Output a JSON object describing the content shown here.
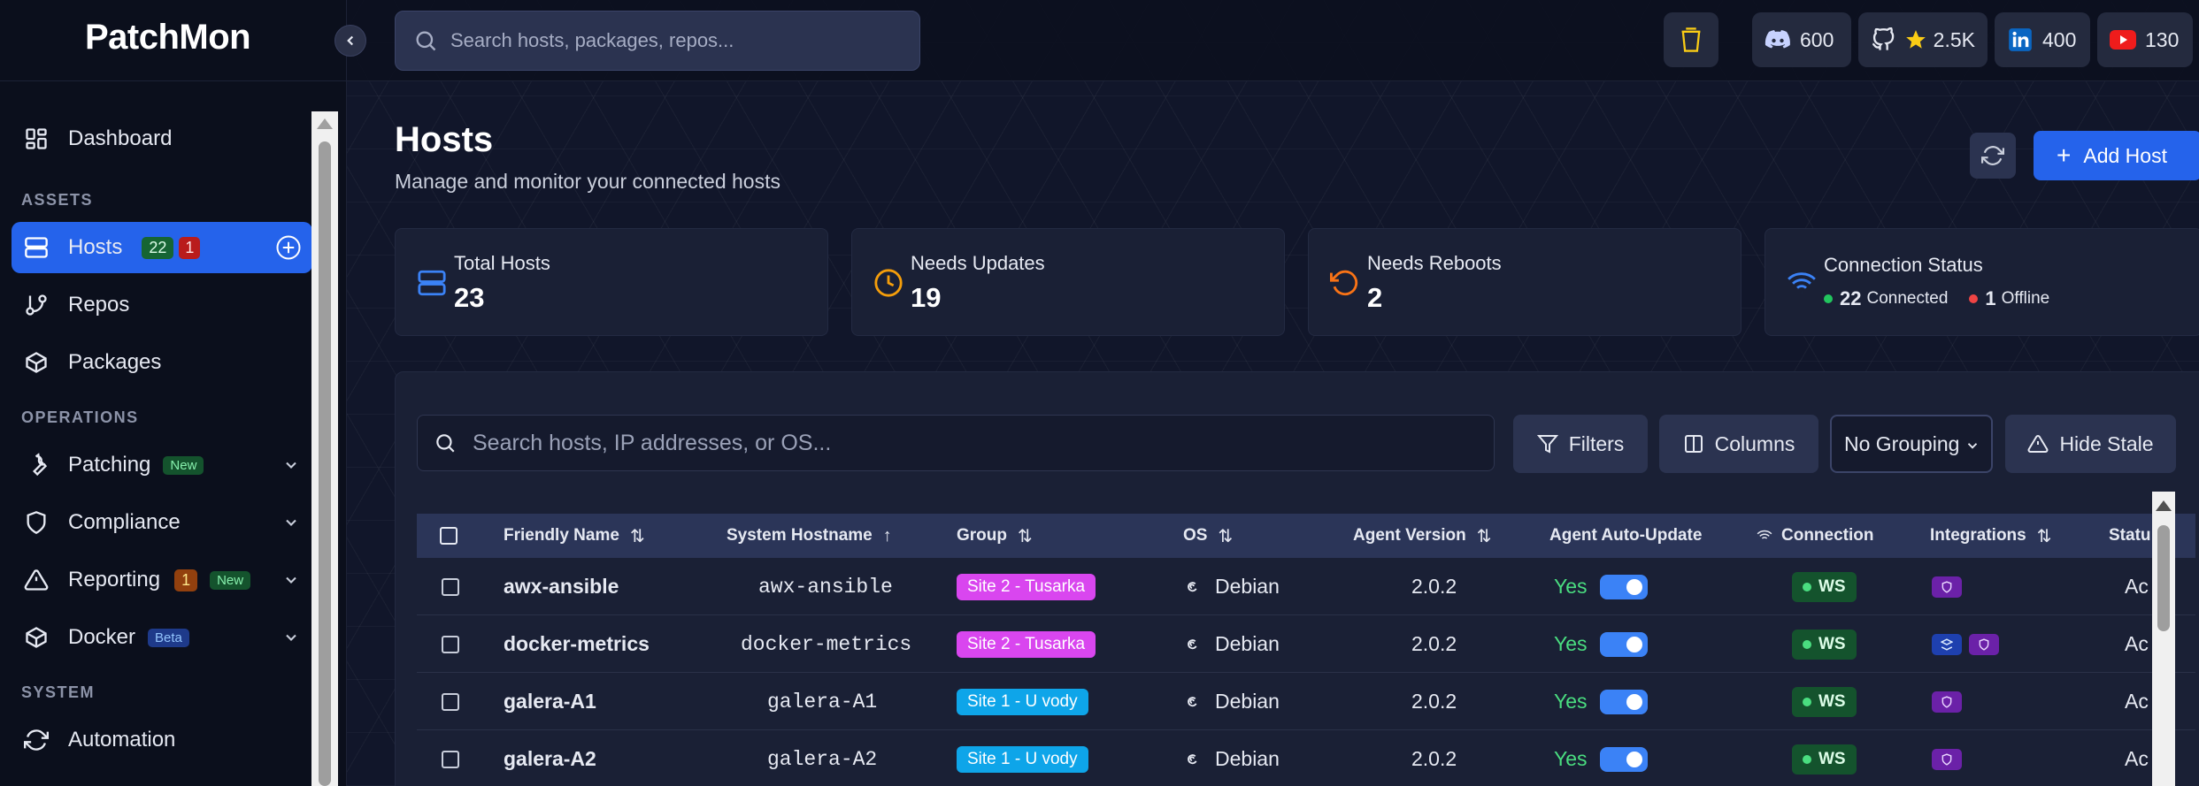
{
  "app": {
    "logo": "PatchMon"
  },
  "sidebar": {
    "dashboard": "Dashboard",
    "section_assets": "ASSETS",
    "hosts": "Hosts",
    "hosts_online": "22",
    "hosts_offline": "1",
    "repos": "Repos",
    "packages": "Packages",
    "section_operations": "OPERATIONS",
    "patching": "Patching",
    "patching_badge": "New",
    "compliance": "Compliance",
    "reporting": "Reporting",
    "reporting_count": "1",
    "reporting_badge": "New",
    "docker": "Docker",
    "docker_badge": "Beta",
    "section_system": "SYSTEM",
    "automation": "Automation"
  },
  "topbar": {
    "search_placeholder": "Search hosts, packages, repos...",
    "discord": "600",
    "github": "2.5K",
    "linkedin": "400",
    "youtube": "130"
  },
  "page": {
    "title": "Hosts",
    "subtitle": "Manage and monitor your connected hosts",
    "add_host": "Add Host"
  },
  "stats": {
    "total_label": "Total Hosts",
    "total_value": "23",
    "updates_label": "Needs Updates",
    "updates_value": "19",
    "reboots_label": "Needs Reboots",
    "reboots_value": "2",
    "conn_label": "Connection Status",
    "connected_value": "22",
    "connected_label": "Connected",
    "offline_value": "1",
    "offline_label": "Offline"
  },
  "toolbar": {
    "search_placeholder": "Search hosts, IP addresses, or OS...",
    "filters": "Filters",
    "columns": "Columns",
    "grouping": "No Grouping",
    "hide_stale": "Hide Stale"
  },
  "table": {
    "headers": {
      "friendly_name": "Friendly Name",
      "system_hostname": "System Hostname",
      "group": "Group",
      "os": "OS",
      "agent_version": "Agent Version",
      "auto_update": "Agent Auto-Update",
      "connection": "Connection",
      "integrations": "Integrations",
      "status": "Statu"
    },
    "rows": [
      {
        "name": "awx-ansible",
        "hostname": "awx-ansible",
        "group": "Site 2 - Tusarka",
        "os": "Debian",
        "version": "2.0.2",
        "auto": "Yes",
        "conn": "WS",
        "status": "Ac"
      },
      {
        "name": "docker-metrics",
        "hostname": "docker-metrics",
        "group": "Site 2 - Tusarka",
        "os": "Debian",
        "version": "2.0.2",
        "auto": "Yes",
        "conn": "WS",
        "status": "Ac"
      },
      {
        "name": "galera-A1",
        "hostname": "galera-A1",
        "group": "Site 1 - U vody",
        "os": "Debian",
        "version": "2.0.2",
        "auto": "Yes",
        "conn": "WS",
        "status": "Ac"
      },
      {
        "name": "galera-A2",
        "hostname": "galera-A2",
        "group": "Site 1 - U vody",
        "os": "Debian",
        "version": "2.0.2",
        "auto": "Yes",
        "conn": "WS",
        "status": "Ac"
      }
    ]
  },
  "colors": {
    "accent": "#2563eb",
    "group_site2": "#d946ef",
    "group_site1": "#0ea5e9",
    "connected": "#22c55e",
    "offline": "#ef4444"
  }
}
